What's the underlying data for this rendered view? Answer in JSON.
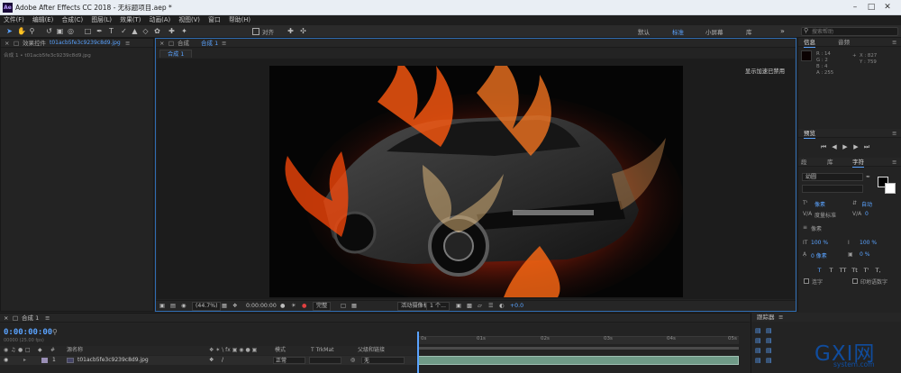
{
  "window": {
    "title": "Adobe After Effects CC 2018 - 无标题项目.aep *",
    "app_icon": "Ae"
  },
  "menu": [
    "文件(F)",
    "编辑(E)",
    "合成(C)",
    "图层(L)",
    "效果(T)",
    "动画(A)",
    "视图(V)",
    "窗口",
    "帮助(H)"
  ],
  "toolbar": {
    "align_label": "对齐",
    "workspaces": [
      "默认",
      "标准",
      "小屏幕",
      "库"
    ],
    "active_workspace": "标准",
    "search_placeholder": "搜索帮助"
  },
  "effects_panel": {
    "tab_label": "效果控件",
    "tab_file": "t01acb5fe3c9239c8d9.jpg",
    "file_line": "合成 1 • t01acb5fe3c9239c8d9.jpg"
  },
  "comp_panel": {
    "tab_label": "合成",
    "tab_name": "合成 1",
    "sub_tab": "合成 1",
    "gpu_note": "显示加速已禁用",
    "footer": {
      "zoom": "(44.7%)",
      "timecode": "0:00:00:00",
      "resolution": "完整",
      "camera": "活动摄像机",
      "views": "1 个...",
      "exposure": "+0.0"
    }
  },
  "info_panel": {
    "tabs": [
      "信息",
      "音频"
    ],
    "r": "R : 14",
    "g": "G : 2",
    "b": "B : 4",
    "a": "A : 255",
    "x": "X : 827",
    "y": "Y : 759"
  },
  "preview_panel": {
    "title": "预览"
  },
  "character_panel": {
    "tabs": [
      "段",
      "库",
      "字符"
    ],
    "font": "幼圆",
    "tracking_label": "度量标准",
    "auto_label": "自动",
    "pixel_label": "像素",
    "scale_v": "100 %",
    "scale_h": "100 %",
    "baseline": "0 像素",
    "tsume": "0 %",
    "value_zero": "0",
    "faux_styles": [
      "T",
      "T",
      "TT",
      "Tt",
      "T'",
      "T,"
    ],
    "ligature": "连字",
    "hindi": "印地语数字"
  },
  "timeline": {
    "tab_label": "合成 1",
    "timecode": "0:00:00:00",
    "fps": "00000 (25.00 fps)",
    "columns": {
      "source": "源名称",
      "mode": "模式",
      "trkmat": "T  TrkMat",
      "parent": "父级和链接"
    },
    "ruler_ticks": [
      "0s",
      "01s",
      "02s",
      "03s",
      "04s",
      "05s"
    ],
    "layer": {
      "index": "1",
      "name": "t01acb5fe3c9239c8d9.jpg",
      "mode": "正常",
      "parent": "无"
    }
  },
  "tracker_panel": {
    "title": "跟踪器"
  },
  "watermark": {
    "logo": "GXI网",
    "site": "system.com"
  }
}
